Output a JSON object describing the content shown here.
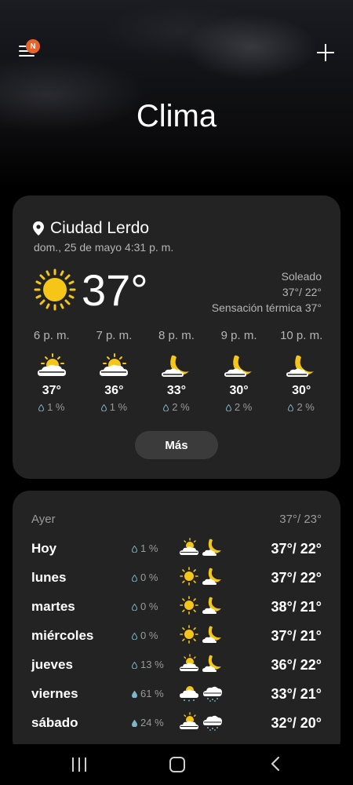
{
  "header": {
    "title": "Clima",
    "badge": "N"
  },
  "current": {
    "city": "Ciudad Lerdo",
    "datetime": "dom., 25 de mayo 4:31 p. m.",
    "temp": "37°",
    "condition": "Soleado",
    "hi_lo": "37°/ 22°",
    "feels_like": "Sensación térmica 37°"
  },
  "hourly": [
    {
      "time": "6 p. m.",
      "icon": "partly-sunny-icon",
      "temp": "37°",
      "precip": "1 %"
    },
    {
      "time": "7 p. m.",
      "icon": "partly-sunny-icon",
      "temp": "36°",
      "precip": "1 %"
    },
    {
      "time": "8 p. m.",
      "icon": "moon-icon",
      "temp": "33°",
      "precip": "2 %"
    },
    {
      "time": "9 p. m.",
      "icon": "moon-icon",
      "temp": "30°",
      "precip": "2 %"
    },
    {
      "time": "10 p. m.",
      "icon": "moon-icon",
      "temp": "30°",
      "precip": "2 %"
    }
  ],
  "more_label": "Más",
  "daily": {
    "yesterday": {
      "label": "Ayer",
      "temps": "37°/ 23°"
    },
    "days": [
      {
        "name": "Hoy",
        "precip": "1 %",
        "day_icon": "partly-sunny-icon",
        "night_icon": "moon-cloud-icon",
        "temps": "37°/ 22°"
      },
      {
        "name": "lunes",
        "precip": "0 %",
        "day_icon": "sun-icon",
        "night_icon": "moon-cloud-icon",
        "temps": "37°/ 22°"
      },
      {
        "name": "martes",
        "precip": "0 %",
        "day_icon": "sun-icon",
        "night_icon": "moon-cloud-icon",
        "temps": "38°/ 21°"
      },
      {
        "name": "miércoles",
        "precip": "0 %",
        "day_icon": "sun-icon",
        "night_icon": "moon-cloud-icon",
        "temps": "37°/ 21°"
      },
      {
        "name": "jueves",
        "precip": "13 %",
        "day_icon": "partly-sunny-icon",
        "night_icon": "moon-cloud-icon",
        "temps": "36°/ 22°"
      },
      {
        "name": "viernes",
        "precip": "61 %",
        "day_icon": "sun-rain-icon",
        "night_icon": "rain-cloud-icon",
        "temps": "33°/ 21°"
      },
      {
        "name": "sábado",
        "precip": "24 %",
        "day_icon": "partly-sunny-icon",
        "night_icon": "rain-cloud-icon",
        "temps": "32°/ 20°"
      }
    ]
  },
  "colors": {
    "accent_sun": "#f5c518",
    "badge": "#e8622c",
    "card": "#232323"
  }
}
